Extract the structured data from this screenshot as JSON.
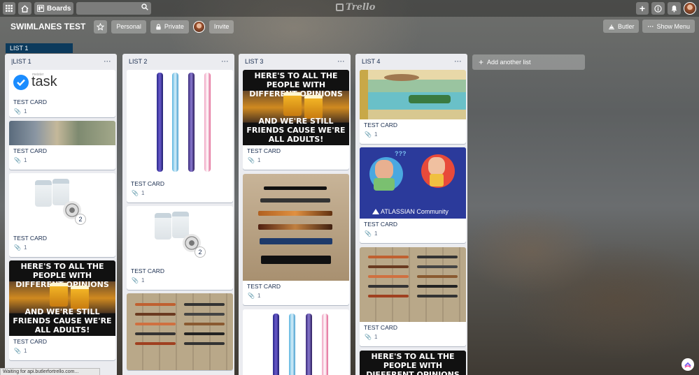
{
  "topbar": {
    "boards_label": "Boards",
    "logo_text": "Trello"
  },
  "board": {
    "title": "SWIMLANES TEST",
    "visibility_team": "Personal",
    "visibility_privacy": "Private",
    "invite_label": "Invite",
    "butler_label": "Butler",
    "show_menu_label": "Show Menu"
  },
  "banner": {
    "label": "LIST 1"
  },
  "lists": [
    {
      "title": "|LIST 1",
      "cards": [
        {
          "title": "TEST CARD",
          "attachments": "1",
          "cover": "meistertask-logo",
          "cover_text": "task",
          "cover_small": "meister"
        },
        {
          "title": "TEST CARD",
          "attachments": "1",
          "cover": "landscape"
        },
        {
          "title": "TEST CARD",
          "attachments": "1",
          "cover": "filter-cups",
          "cover_count": "2"
        },
        {
          "title": "TEST CARD",
          "attachments": "1",
          "cover": "friends-meme"
        }
      ]
    },
    {
      "title": "LIST 2",
      "cards": [
        {
          "title": "TEST CARD",
          "attachments": "1",
          "cover": "fountain-pens"
        },
        {
          "title": "TEST CARD",
          "attachments": "1",
          "cover": "filter-cups",
          "cover_count": "2"
        },
        {
          "title": "",
          "attachments": "",
          "cover": "pens-on-wood"
        }
      ]
    },
    {
      "title": "LIST 3",
      "cards": [
        {
          "title": "TEST CARD",
          "attachments": "1",
          "cover": "friends-meme"
        },
        {
          "title": "TEST CARD",
          "attachments": "1",
          "cover": "pen-rack"
        },
        {
          "title": "",
          "attachments": "",
          "cover": "fountain-pens"
        }
      ]
    },
    {
      "title": "LIST 4",
      "cards": [
        {
          "title": "TEST CARD",
          "attachments": "1",
          "cover": "cartoon-pool"
        },
        {
          "title": "TEST CARD",
          "attachments": "1",
          "cover": "atlassian-community",
          "cover_text": "ATLASSIAN Community"
        },
        {
          "title": "TEST CARD",
          "attachments": "1",
          "cover": "pens-on-wood"
        },
        {
          "title": "",
          "attachments": "",
          "cover": "friends-meme"
        }
      ]
    }
  ],
  "meme": {
    "top": "HERE'S TO ALL THE PEOPLE WITH DIFFERENT OPINIONS",
    "bottom": "AND WE'RE STILL FRIENDS CAUSE WE'RE ALL ADULTS!"
  },
  "add_list_label": "Add another list",
  "status_text": "Waiting for api.butlerfortrello.com...",
  "colors": {
    "list_bg": "#ebecf0",
    "banner": "#0c3a5c",
    "meister_blue": "#1a8cff",
    "atlassian_blue": "#2b3a9b"
  }
}
